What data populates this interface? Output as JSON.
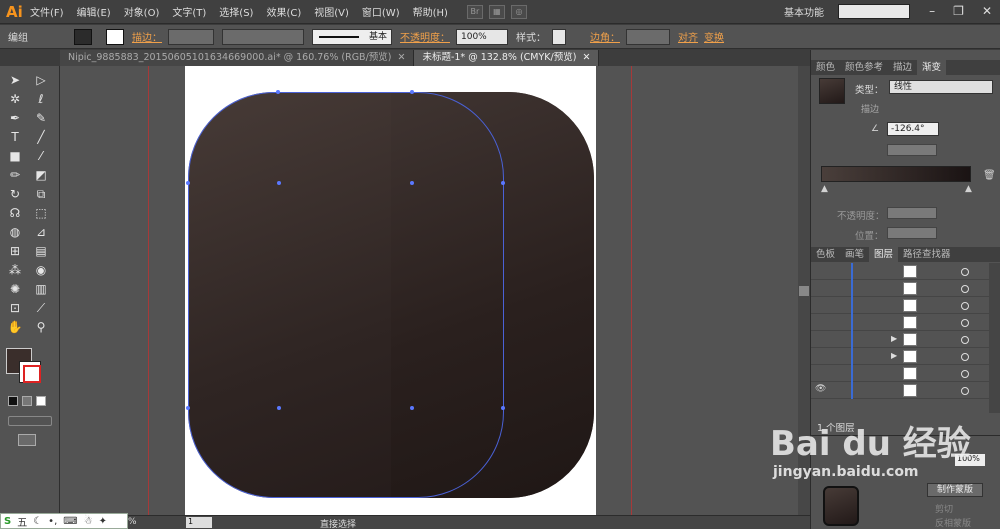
{
  "menubar": {
    "logo": "Ai",
    "items": [
      "文件(F)",
      "编辑(E)",
      "对象(O)",
      "文字(T)",
      "选择(S)",
      "效果(C)",
      "视图(V)",
      "窗口(W)",
      "帮助(H)"
    ],
    "workspace": "基本功能"
  },
  "control_bar": {
    "selection_label": "编组",
    "stroke_label": "描边：",
    "stroke_profile": "基本",
    "opacity_label": "不透明度：",
    "opacity_value": "100%",
    "style_label": "样式：",
    "corner_label": "边角：",
    "align_label": "对齐",
    "transform_label": "变换"
  },
  "tabs": [
    {
      "label": "Nipic_9885883_20150605101634669000.ai* @ 160.76% (RGB/预览)",
      "active": false
    },
    {
      "label": "未标题-1* @ 132.8% (CMYK/预览)",
      "active": true
    }
  ],
  "status": {
    "zoom": "%",
    "page": "1",
    "tool": "直接选择"
  },
  "ime_label": "五",
  "right_panel": {
    "top_tabs": [
      "颜色",
      "颜色参考",
      "描边",
      "渐变"
    ],
    "gradient": {
      "type_label": "类型：",
      "type_value": "线性",
      "stroke_label": "描边",
      "angle_value": "-126.4°",
      "opacity_label": "不透明度：",
      "location_label": "位置："
    },
    "layer_tabs": [
      "色板",
      "画笔",
      "图层",
      "路径查找器"
    ],
    "layers_count": "1 个图层",
    "transparency_opacity": "100%",
    "make_mask": "制作蒙版",
    "clip": "剪切",
    "invert_mask": "反相蒙版"
  },
  "watermark": {
    "brand": "Bai du 经验",
    "url": "jingyan.baidu.com"
  },
  "colors": {
    "accent_orange": "#f7941d",
    "selection_blue": "#4a61d6",
    "guide_red": "#b33333"
  },
  "icons": [
    "selection-tool-icon",
    "direct-selection-tool-icon",
    "magic-wand-icon",
    "lasso-icon",
    "pen-icon",
    "curvature-icon",
    "type-icon",
    "line-icon",
    "rectangle-icon",
    "paintbrush-icon",
    "pencil-icon",
    "eraser-icon",
    "rotate-icon",
    "scale-icon",
    "warp-icon",
    "free-transform-icon",
    "shape-builder-icon",
    "perspective-icon",
    "mesh-icon",
    "gradient-icon",
    "eyedropper-icon",
    "blend-icon",
    "symbol-sprayer-icon",
    "column-graph-icon",
    "artboard-icon",
    "slice-icon",
    "hand-icon",
    "zoom-icon"
  ]
}
